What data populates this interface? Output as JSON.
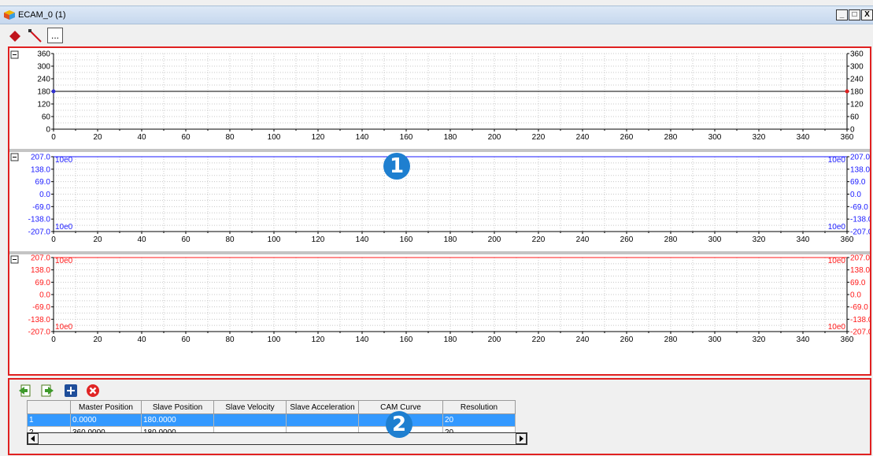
{
  "window": {
    "title": "ECAM_0 (1)",
    "controls": [
      "_",
      "□",
      "X"
    ]
  },
  "toolbar": {
    "items": [
      {
        "name": "add-point-tool",
        "icon": "red-diamond-icon"
      },
      {
        "name": "draw-line-tool",
        "icon": "line-icon"
      },
      {
        "name": "more-options-button",
        "label": "..."
      }
    ]
  },
  "charts": {
    "position_ticks": [
      "360",
      "300",
      "240",
      "180",
      "120",
      "60",
      "0"
    ],
    "signed_ticks": [
      "207.0",
      "138.0",
      "69.0",
      "0.0",
      "-69.0",
      "-138.0",
      "-207.0"
    ],
    "x_ticks": [
      "0",
      "20",
      "40",
      "60",
      "80",
      "100",
      "120",
      "140",
      "160",
      "180",
      "200",
      "220",
      "240",
      "260",
      "280",
      "300",
      "320",
      "340",
      "360"
    ],
    "scale_label": "10e0",
    "colors": {
      "position": "#000000",
      "velocity": "#1a1aff",
      "acceleration": "#ff1a1a",
      "point": "#3030d0"
    }
  },
  "chart_data": [
    {
      "type": "line",
      "title": "",
      "series": [
        {
          "x": [
            0,
            360
          ],
          "y": [
            180,
            180
          ]
        }
      ],
      "xlim": [
        0,
        360
      ],
      "ylim": [
        0,
        360
      ],
      "grid": true
    },
    {
      "type": "line",
      "title": "",
      "series": [
        {
          "x": [
            0,
            360
          ],
          "y": [
            207.0,
            207.0
          ]
        }
      ],
      "xlim": [
        0,
        360
      ],
      "ylim": [
        -207.0,
        207.0
      ],
      "grid": true
    },
    {
      "type": "line",
      "title": "",
      "series": [
        {
          "x": [
            0,
            360
          ],
          "y": [
            207.0,
            207.0
          ]
        }
      ],
      "xlim": [
        0,
        360
      ],
      "ylim": [
        -207.0,
        207.0
      ],
      "grid": true
    }
  ],
  "badges": {
    "one": "1",
    "two": "2"
  },
  "bottom_toolbar": [
    "import-icon",
    "export-icon",
    "add-row-icon",
    "delete-row-icon"
  ],
  "table": {
    "columns": [
      "",
      "Master Position",
      "Slave Position",
      "Slave Velocity",
      "Slave Acceleration",
      "CAM Curve",
      "Resolution"
    ],
    "rows": [
      [
        "1",
        "0.0000",
        "180.0000",
        "",
        "",
        "",
        "20"
      ],
      [
        "2",
        "360.0000",
        "180.0000",
        "",
        "",
        "",
        "20"
      ]
    ],
    "selected_row": 0
  }
}
